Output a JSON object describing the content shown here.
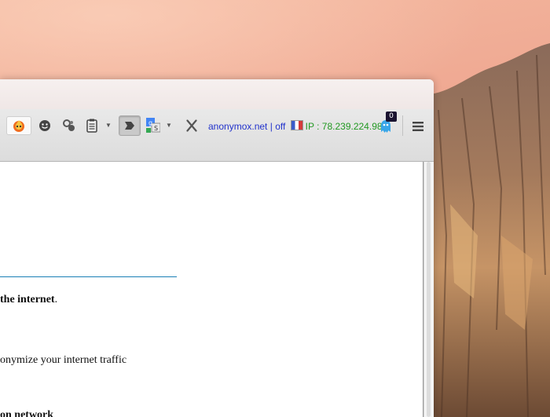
{
  "toolbar": {
    "items": [
      {
        "name": "hola-unblocker-icon"
      },
      {
        "name": "smiley-icon"
      },
      {
        "name": "link-circles-icon"
      },
      {
        "name": "clipboard-icon"
      },
      {
        "name": "readability-icon"
      },
      {
        "name": "google-translate-icon"
      },
      {
        "name": "x-icon"
      }
    ],
    "anonymox": {
      "service": "anonymox.net",
      "separator": "|",
      "status": "off",
      "ip_label": "IP : 78.239.224.98"
    },
    "ghostery_badge": "0",
    "menu_icon": "hamburger-menu-icon"
  },
  "content": {
    "line1": {
      "bold": "the internet",
      "tail": "."
    },
    "line2": "onymize your internet traffic",
    "line3": "on network"
  },
  "colors": {
    "link_blue": "#2233cc",
    "ip_green": "#229922",
    "divider_blue": "#1a7fb5"
  }
}
